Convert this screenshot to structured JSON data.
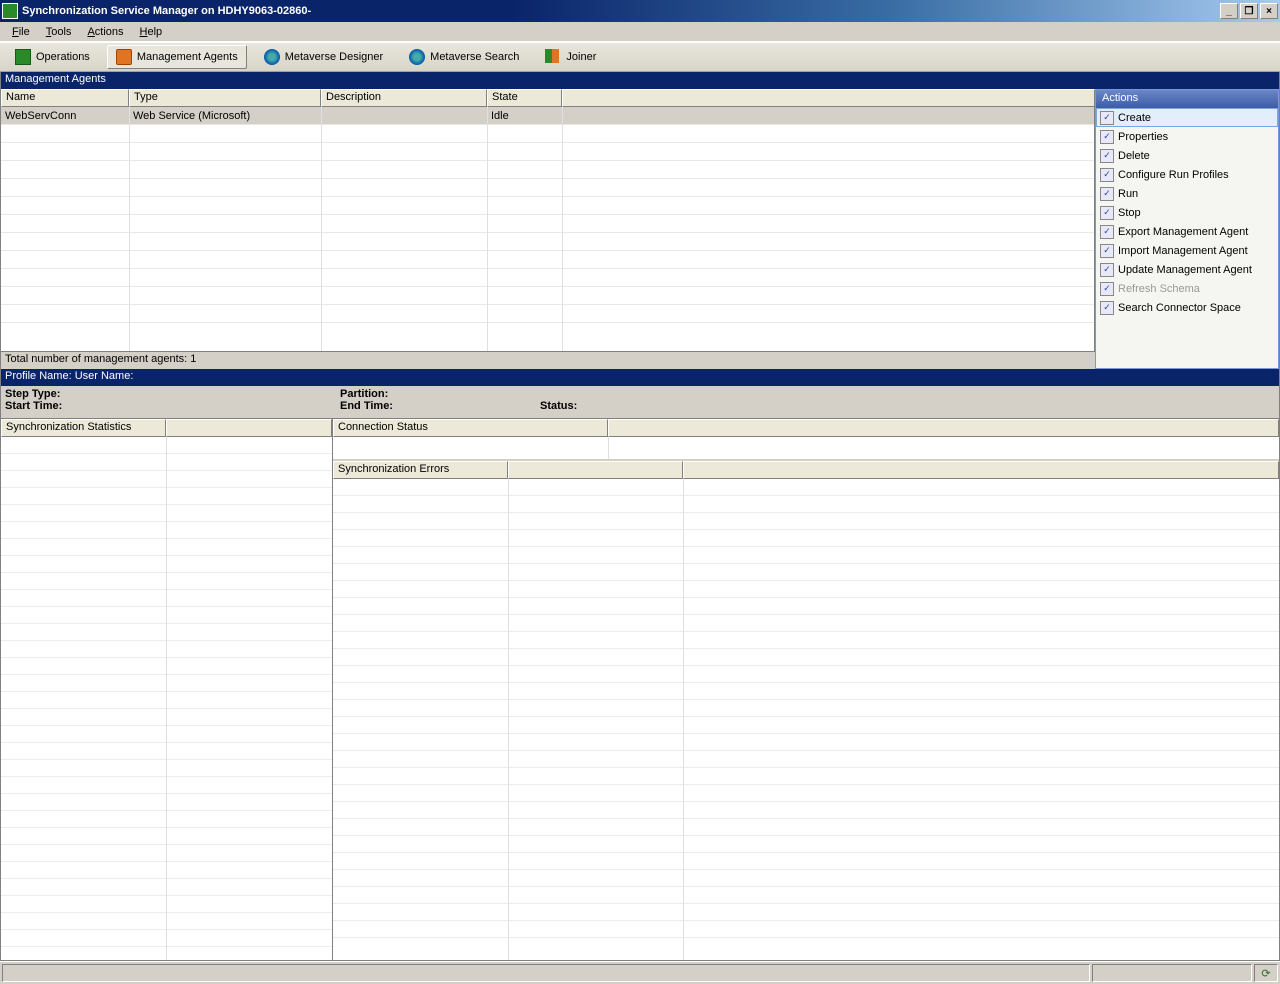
{
  "window": {
    "title": "Synchronization Service Manager on HDHY9063-02860-"
  },
  "menubar": {
    "file": "File",
    "tools": "Tools",
    "actions": "Actions",
    "help": "Help"
  },
  "toolbar": {
    "operations": "Operations",
    "management_agents": "Management Agents",
    "metaverse_designer": "Metaverse Designer",
    "metaverse_search": "Metaverse Search",
    "joiner": "Joiner"
  },
  "ma_section": {
    "title": "Management Agents",
    "columns": {
      "name": "Name",
      "type": "Type",
      "description": "Description",
      "state": "State"
    },
    "rows": [
      {
        "name": "WebServConn",
        "type": "Web Service (Microsoft)",
        "description": "",
        "state": "Idle"
      }
    ],
    "count_label": "Total number of management agents: 1"
  },
  "actions": {
    "title": "Actions",
    "items": [
      {
        "label": "Create",
        "selected": true
      },
      {
        "label": "Properties"
      },
      {
        "label": "Delete"
      },
      {
        "label": "Configure Run Profiles"
      },
      {
        "label": "Run"
      },
      {
        "label": "Stop"
      },
      {
        "label": "Export Management Agent"
      },
      {
        "label": "Import Management Agent"
      },
      {
        "label": "Update Management Agent"
      },
      {
        "label": "Refresh Schema",
        "disabled": true
      },
      {
        "label": "Search Connector Space"
      }
    ]
  },
  "profile": {
    "header": "Profile Name:   User Name:",
    "step_type": "Step Type:",
    "start_time": "Start Time:",
    "partition": "Partition:",
    "end_time": "End Time:",
    "status": "Status:"
  },
  "panels": {
    "sync_stats": "Synchronization Statistics",
    "conn_status": "Connection Status",
    "sync_errors": "Synchronization Errors"
  }
}
